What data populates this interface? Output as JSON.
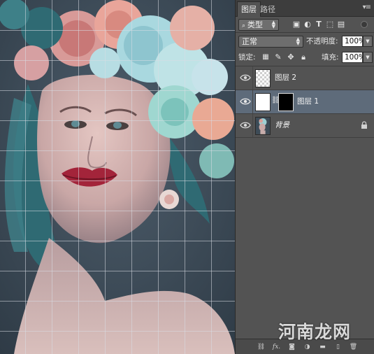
{
  "canvas": {
    "image": "portrait-flower-crown",
    "grid": true
  },
  "panel": {
    "tabs": [
      {
        "label": "图层",
        "active": true
      },
      {
        "label": "路径",
        "active": false
      }
    ],
    "filter": {
      "label": "类型"
    },
    "blend_mode": {
      "value": "正常"
    },
    "opacity": {
      "label": "不透明度:",
      "value": "100%"
    },
    "lock": {
      "label": "锁定:"
    },
    "fill": {
      "label": "填充:",
      "value": "100%"
    },
    "layers": [
      {
        "name": "图层 2",
        "visible": true,
        "thumb": "transparent-checker"
      },
      {
        "name": "图层 1",
        "visible": true,
        "thumb": "white",
        "mask": "black",
        "selected": true
      },
      {
        "name": "背景",
        "visible": true,
        "thumb": "photo",
        "locked": true
      }
    ]
  },
  "watermark": {
    "text": "河南龙网"
  },
  "colors": {
    "panel_bg": "#535353",
    "selected_row": "#5e6b7a",
    "tab_bar": "#3d3d3d"
  }
}
